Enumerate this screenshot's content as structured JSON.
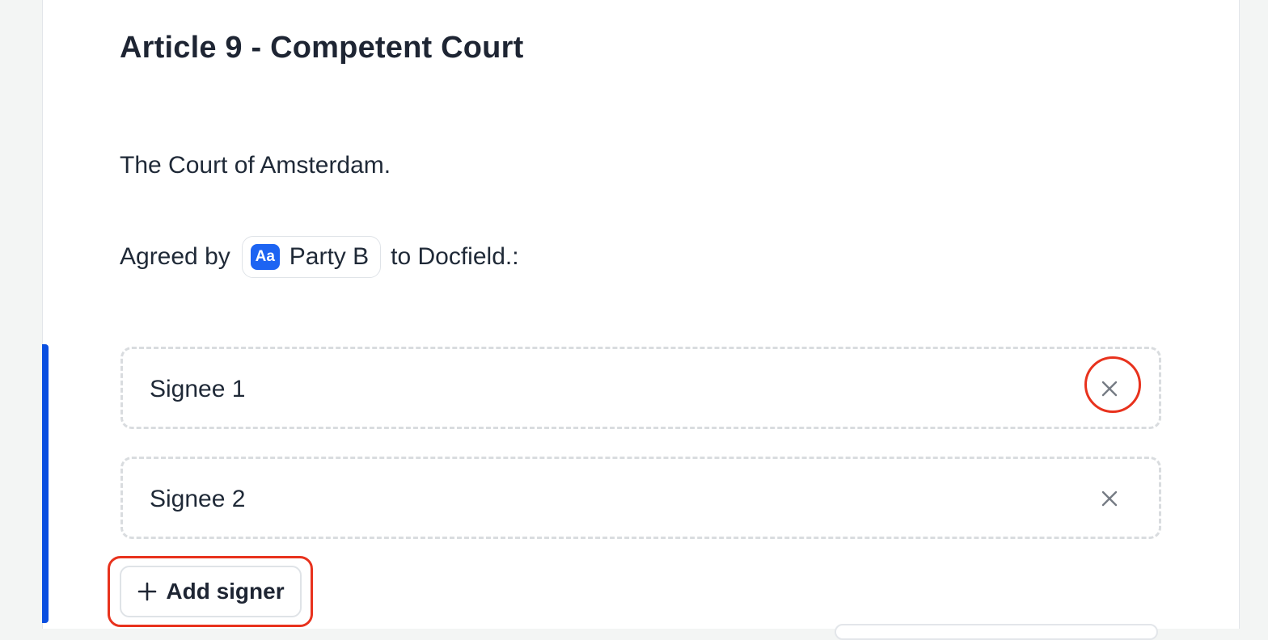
{
  "article": {
    "title": "Article 9 - Competent Court",
    "body": "The Court of Amsterdam."
  },
  "agreement": {
    "prefix": "Agreed by",
    "variable": {
      "icon": "text-variable-icon",
      "icon_text": "Aa",
      "label": "Party B"
    },
    "suffix": "to Docfield.:"
  },
  "signees": [
    {
      "label": "Signee 1",
      "remove_icon": "close-icon"
    },
    {
      "label": "Signee 2",
      "remove_icon": "close-icon"
    }
  ],
  "add_signer": {
    "icon": "plus-icon",
    "label": "Add signer"
  },
  "colors": {
    "accent": "#0a4fe0",
    "chip_icon": "#1d64f2",
    "highlight": "#e8321d"
  }
}
